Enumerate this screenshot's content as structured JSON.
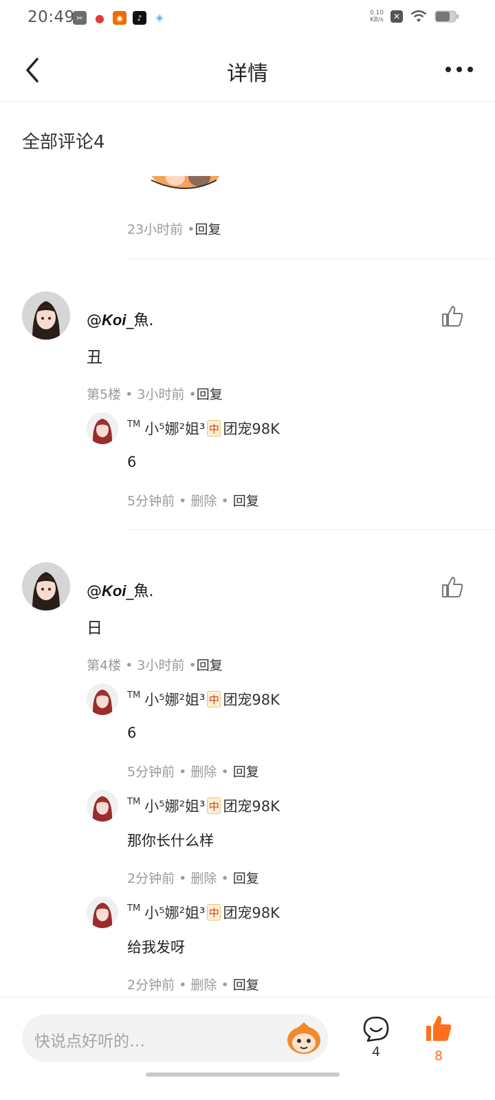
{
  "status_bar": {
    "time": "20:49",
    "net_speed_value": "0.10",
    "net_speed_unit": "KB/s",
    "icons": [
      "scissors-icon",
      "balloon-icon",
      "game-icon",
      "tiktok-icon",
      "kite-icon",
      "close-box-icon",
      "wifi-icon",
      "battery-icon"
    ]
  },
  "nav": {
    "title": "详情",
    "back_icon": "back-arrow-icon",
    "more_icon": "more-dots-icon"
  },
  "section_title": "全部评论4",
  "top_partial": {
    "time": "23小时前",
    "reply": "回复"
  },
  "comments": [
    {
      "user_prefix": "@",
      "user_koi": "Koi",
      "user_suffix": "_魚.",
      "text": "丑",
      "floor": "第5楼",
      "time": "3小时前",
      "reply": "回复",
      "replies": [
        {
          "name_tm": "TM",
          "name_main": "小⁵娜²姐³",
          "tile": "中",
          "name_tail": "团宠98K",
          "text": "6",
          "time": "5分钟前",
          "delete": "删除",
          "reply": "回复"
        }
      ]
    },
    {
      "user_prefix": "@",
      "user_koi": "Koi",
      "user_suffix": "_魚.",
      "text": "日",
      "floor": "第4楼",
      "time": "3小时前",
      "reply": "回复",
      "replies": [
        {
          "name_tm": "TM",
          "name_main": "小⁵娜²姐³",
          "tile": "中",
          "name_tail": "团宠98K",
          "text": "6",
          "time": "5分钟前",
          "delete": "删除",
          "reply": "回复"
        },
        {
          "name_tm": "TM",
          "name_main": "小⁵娜²姐³",
          "tile": "中",
          "name_tail": "团宠98K",
          "text": "那你长什么样",
          "time": "2分钟前",
          "delete": "删除",
          "reply": "回复"
        },
        {
          "name_tm": "TM",
          "name_main": "小⁵娜²姐³",
          "tile": "中",
          "name_tail": "团宠98K",
          "text": "给我发呀",
          "time": "2分钟前",
          "delete": "删除",
          "reply": "回复"
        }
      ]
    }
  ],
  "bottom_bar": {
    "input_placeholder": "快说点好听的…",
    "comment_count": "4",
    "like_count": "8"
  },
  "colors": {
    "accent": "#ff6f1e",
    "muted": "#9a9a9a",
    "divider": "#ececec"
  }
}
